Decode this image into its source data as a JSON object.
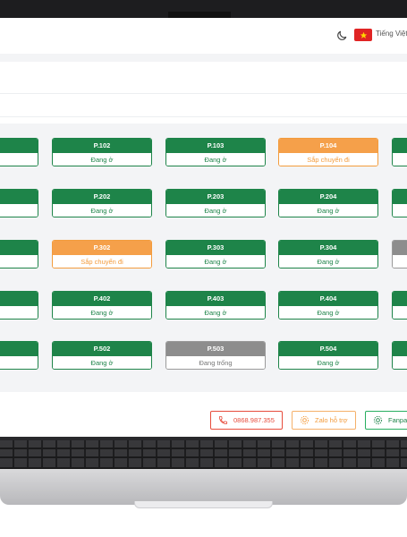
{
  "header": {
    "language": "Tiếng Việt"
  },
  "rooms": [
    {
      "name": "P.102",
      "status": "Đang ở",
      "state": "occupied"
    },
    {
      "name": "P.103",
      "status": "Đang ở",
      "state": "occupied"
    },
    {
      "name": "P.104",
      "status": "Sắp chuyển đi",
      "state": "leaving"
    },
    {
      "name": "P.202",
      "status": "Đang ở",
      "state": "occupied"
    },
    {
      "name": "P.203",
      "status": "Đang ở",
      "state": "occupied"
    },
    {
      "name": "P.204",
      "status": "Đang ở",
      "state": "occupied"
    },
    {
      "name": "P.302",
      "status": "Sắp chuyển đi",
      "state": "leaving"
    },
    {
      "name": "P.303",
      "status": "Đang ở",
      "state": "occupied"
    },
    {
      "name": "P.304",
      "status": "Đang ở",
      "state": "occupied"
    },
    {
      "name": "P.402",
      "status": "Đang ở",
      "state": "occupied"
    },
    {
      "name": "P.403",
      "status": "Đang ở",
      "state": "occupied"
    },
    {
      "name": "P.404",
      "status": "Đang ở",
      "state": "occupied"
    },
    {
      "name": "P.502",
      "status": "Đang ở",
      "state": "occupied"
    },
    {
      "name": "P.503",
      "status": "Đang trống",
      "state": "vacant"
    },
    {
      "name": "P.504",
      "status": "Đang ở",
      "state": "occupied"
    }
  ],
  "footer": {
    "phone_label": "0868.987.355",
    "zalo_label": "Zalo hỗ trợ",
    "fanpage_label": "Fanpage"
  },
  "colors": {
    "occupied": "#1e8449",
    "leaving": "#f5a04a",
    "vacant": "#8d8d8d"
  }
}
